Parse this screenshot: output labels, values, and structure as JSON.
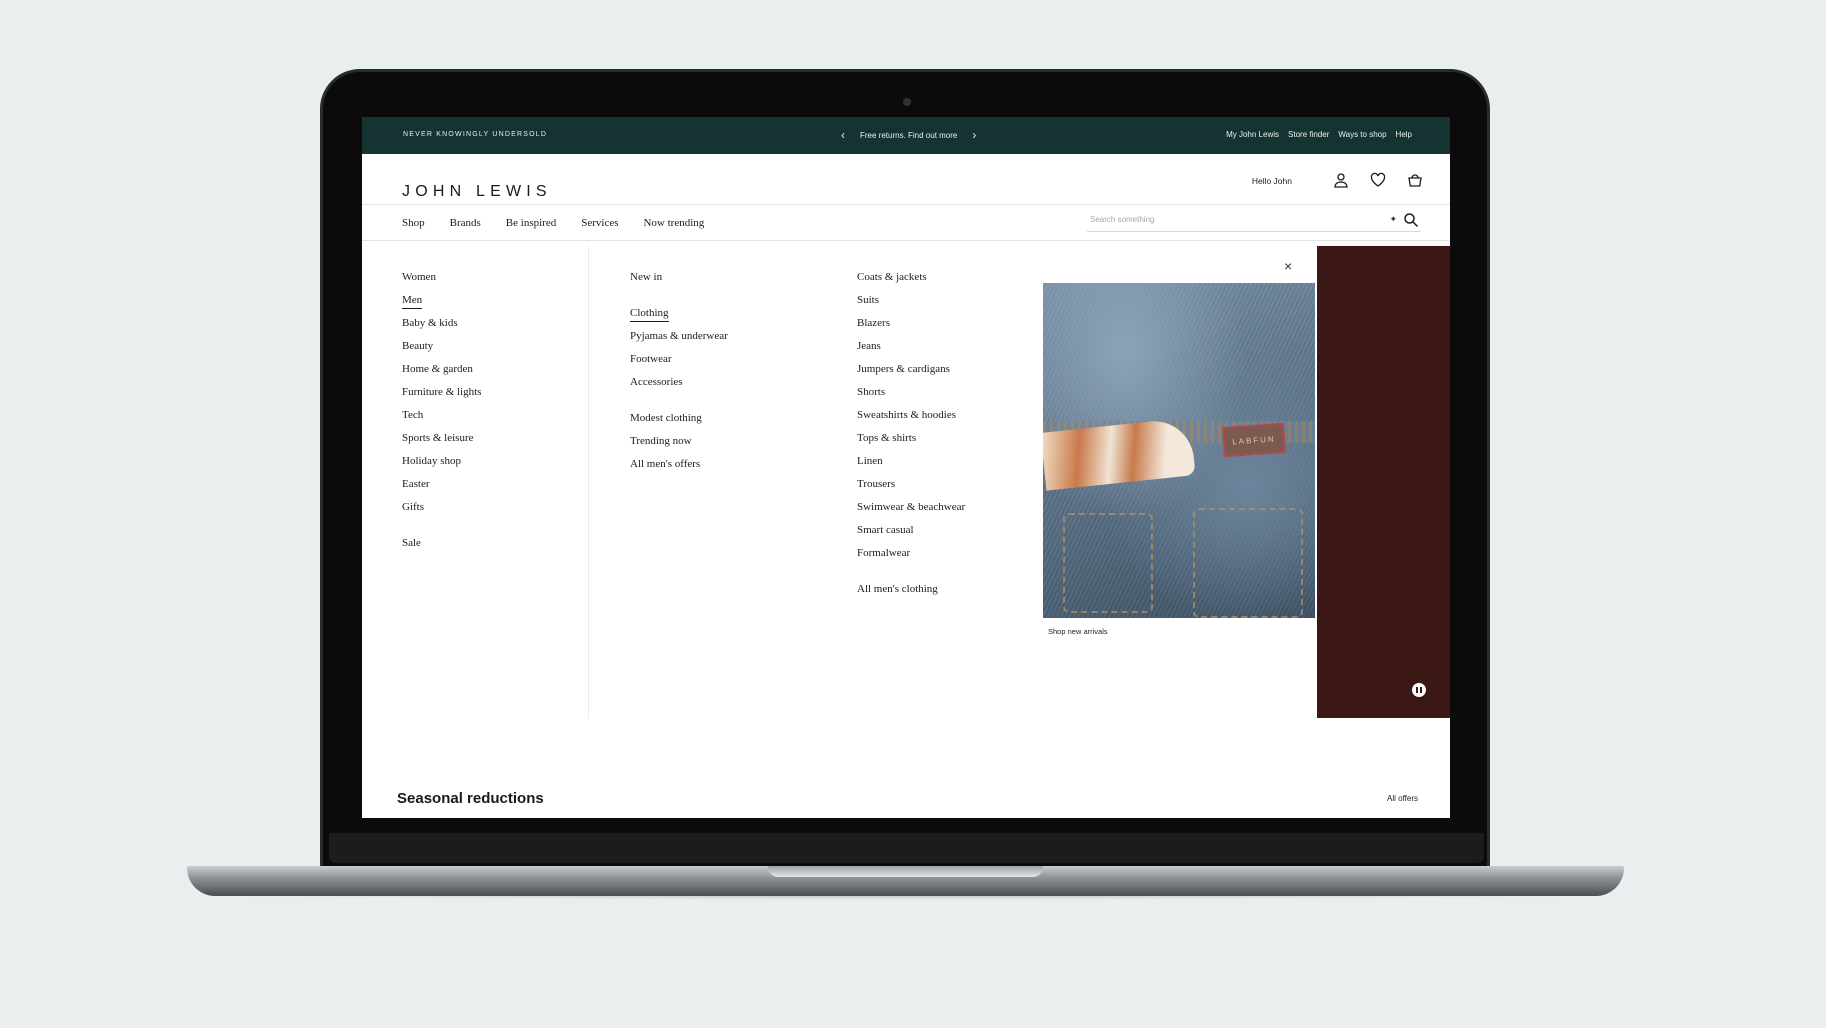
{
  "topbar": {
    "tagline": "NEVER KNOWINGLY UNDERSOLD",
    "promo": "Free returns.  Find out more",
    "links": [
      "My John Lewis",
      "Store finder",
      "Ways to shop",
      "Help"
    ],
    "background": "#143331"
  },
  "header": {
    "logo": "JOHN LEWIS",
    "greeting": "Hello John",
    "icons": [
      "account-icon",
      "heart-icon",
      "basket-icon"
    ]
  },
  "nav": {
    "items": [
      "Shop",
      "Brands",
      "Be inspired",
      "Services",
      "Now trending"
    ],
    "search_placeholder": "Search something"
  },
  "menu": {
    "departments": [
      "Women",
      "Men",
      "Baby & kids",
      "Beauty",
      "Home & garden",
      "Furniture & lights",
      "Tech",
      "Sports & leisure",
      "Holiday shop",
      "Easter",
      "Gifts"
    ],
    "sale": "Sale",
    "active_department": "Men",
    "men_top": "New in",
    "men_categories": [
      "Clothing",
      "Pyjamas & underwear",
      "Footwear",
      "Accessories"
    ],
    "men_extra": [
      "Modest clothing",
      "Trending now",
      "All men's offers"
    ],
    "active_category": "Clothing",
    "clothing": [
      "Coats & jackets",
      "Suits",
      "Blazers",
      "Jeans",
      "Jumpers & cardigans",
      "Shorts",
      "Sweatshirts & hoodies",
      "Tops & shirts",
      "Linen",
      "Trousers",
      "Swimwear & beachwear",
      "Smart casual",
      "Formalwear"
    ],
    "all_clothing": "All men's clothing",
    "close_glyph": "×",
    "promo_caption": "Shop new arrivals",
    "promo_patch_text": "LABFUN"
  },
  "below": {
    "heading": "Seasonal reductions",
    "all_offers": "All offers"
  },
  "colors": {
    "side_panel": "#3b1716",
    "background": "#e9eeee"
  }
}
